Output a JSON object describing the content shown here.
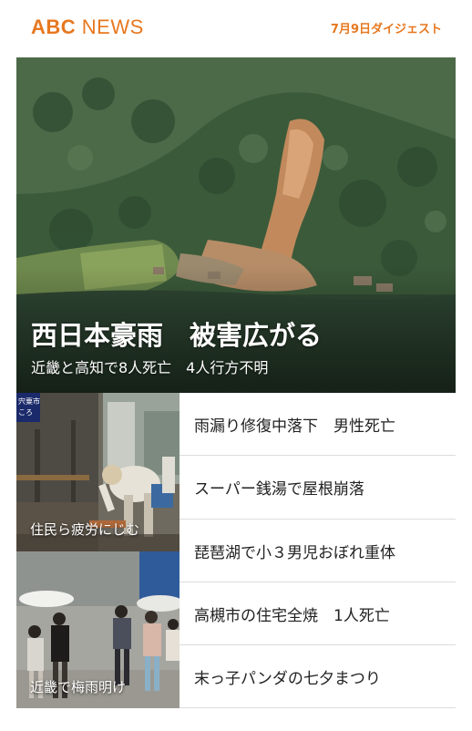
{
  "header": {
    "logo_abc": "ABC",
    "logo_news": "NEWS",
    "digest_label": "7月9日ダイジェスト"
  },
  "hero": {
    "title": "西日本豪雨　被害広がる",
    "subtitle": "近畿と高知で8人死亡　4人行方不明"
  },
  "thumbs": [
    {
      "caption": "住民ら疲労にじむ",
      "sign_text_1": "宍粟市",
      "sign_text_2": "ころ"
    },
    {
      "caption": "近畿で梅雨明け"
    }
  ],
  "news_list": [
    {
      "label": "雨漏り修復中落下　男性死亡"
    },
    {
      "label": "スーパー銭湯で屋根崩落"
    },
    {
      "label": "琵琶湖で小３男児おぼれ重体"
    },
    {
      "label": "高槻市の住宅全焼　1人死亡"
    },
    {
      "label": "末っ子パンダの七夕まつり"
    }
  ],
  "colors": {
    "brand_orange": "#e7781f",
    "divider": "#dcdcdc"
  }
}
